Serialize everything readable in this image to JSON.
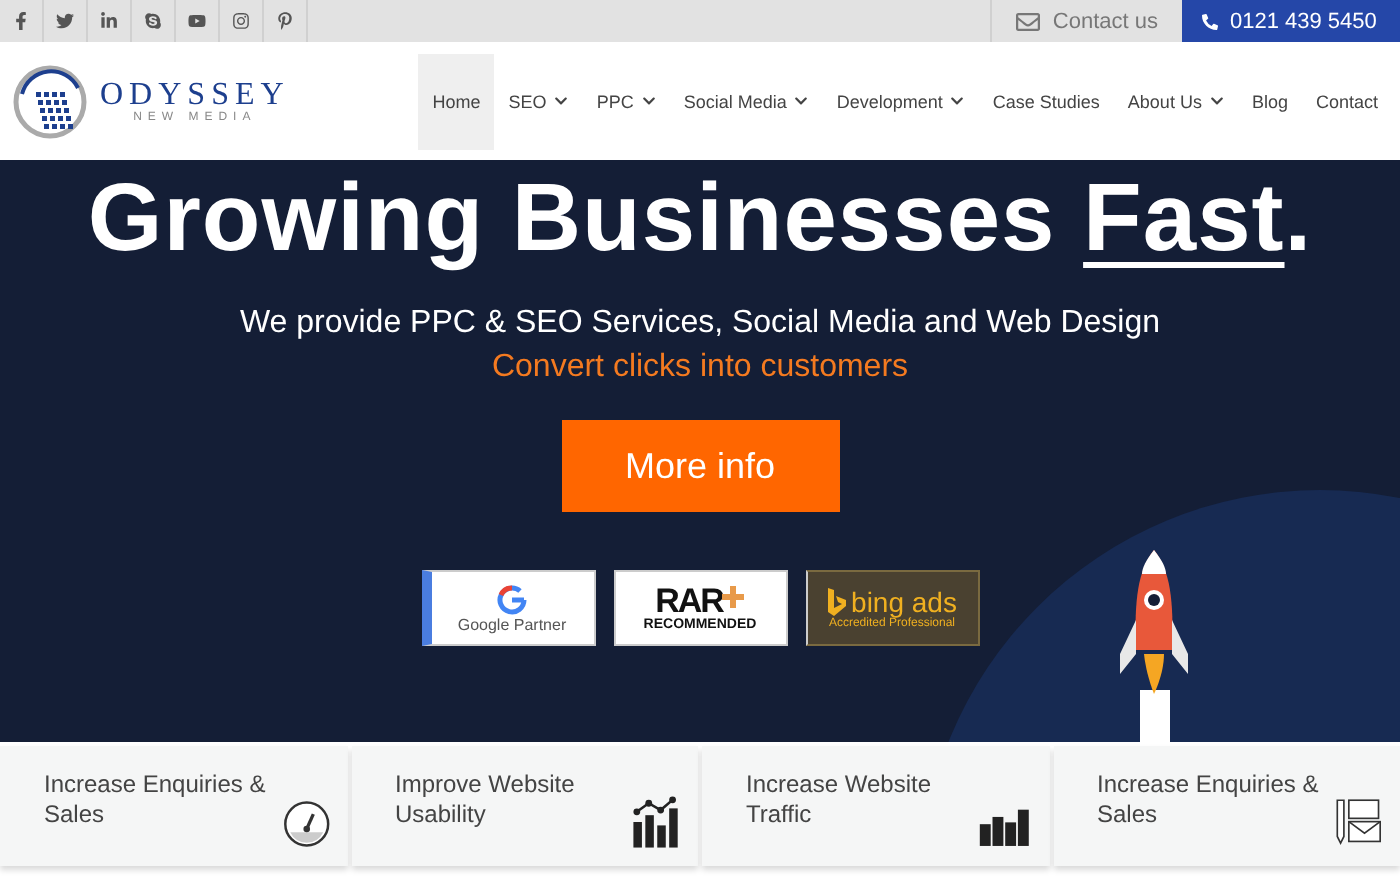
{
  "topbar": {
    "contact_label": "Contact us",
    "phone": "0121 439 5450"
  },
  "logo": {
    "name": "ODYSSEY",
    "tagline": "NEW MEDIA"
  },
  "nav": [
    {
      "label": "Home",
      "selected": true,
      "dropdown": false
    },
    {
      "label": "SEO",
      "selected": false,
      "dropdown": true
    },
    {
      "label": "PPC",
      "selected": false,
      "dropdown": true
    },
    {
      "label": "Social Media",
      "selected": false,
      "dropdown": true
    },
    {
      "label": "Development",
      "selected": false,
      "dropdown": true
    },
    {
      "label": "Case Studies",
      "selected": false,
      "dropdown": false
    },
    {
      "label": "About Us",
      "selected": false,
      "dropdown": true
    },
    {
      "label": "Blog",
      "selected": false,
      "dropdown": false
    },
    {
      "label": "Contact",
      "selected": false,
      "dropdown": false
    }
  ],
  "hero": {
    "title": [
      {
        "text": "Growing Businesses ",
        "underlined": false
      },
      {
        "text": "Fast",
        "underlined": true
      },
      {
        "text": ".",
        "underlined": false
      }
    ],
    "subtitle": "We provide PPC & SEO Services, Social Media and Web Design",
    "tagline": "Convert clicks into customers",
    "button": "More info"
  },
  "badges": [
    {
      "kind": "google",
      "label": "Google Partner"
    },
    {
      "kind": "rar",
      "label": "RAR",
      "sublabel": "RECOMMENDED"
    },
    {
      "kind": "bing",
      "label": "bing ads",
      "sublabel": "Accredited Professional"
    }
  ],
  "features": [
    {
      "kind": "gauge",
      "label": "Increase Enquiries & Sales"
    },
    {
      "kind": "linechart",
      "label": "Improve Website Usability"
    },
    {
      "kind": "bars",
      "label": "Increase Website Traffic"
    },
    {
      "kind": "mail",
      "label": "Increase Enquiries & Sales"
    }
  ]
}
